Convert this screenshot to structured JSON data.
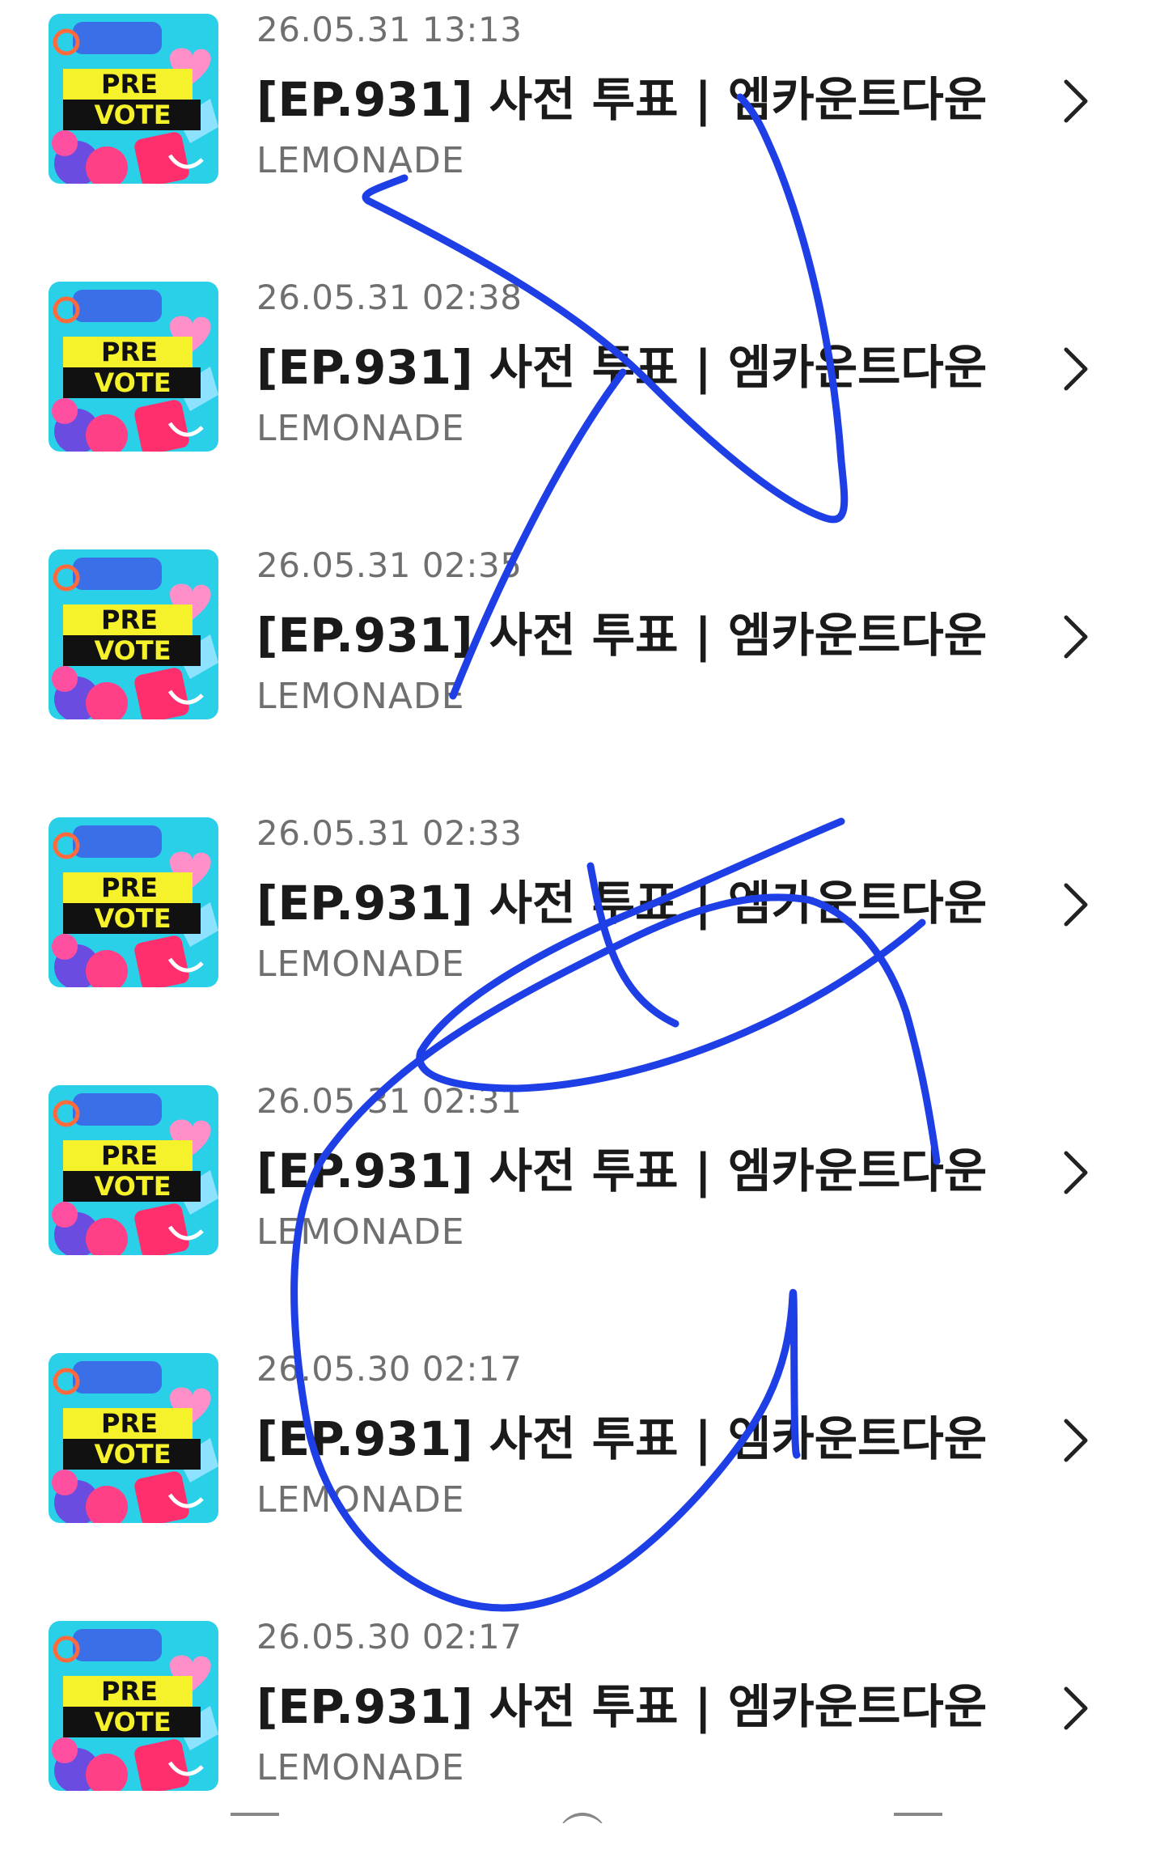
{
  "items": [
    {
      "date": "26.05.31 13:13",
      "title": "[EP.931] 사전 투표 | 엠카운트다운",
      "artist": "LEMONADE",
      "thumb_line1": "PRE",
      "thumb_line2": "VOTE"
    },
    {
      "date": "26.05.31 02:38",
      "title": "[EP.931] 사전 투표 | 엠카운트다운",
      "artist": "LEMONADE",
      "thumb_line1": "PRE",
      "thumb_line2": "VOTE"
    },
    {
      "date": "26.05.31 02:35",
      "title": "[EP.931] 사전 투표 | 엠카운트다운",
      "artist": "LEMONADE",
      "thumb_line1": "PRE",
      "thumb_line2": "VOTE"
    },
    {
      "date": "26.05.31 02:33",
      "title": "[EP.931] 사전 투표 | 엠카운트다운",
      "artist": "LEMONADE",
      "thumb_line1": "PRE",
      "thumb_line2": "VOTE"
    },
    {
      "date": "26.05.31 02:31",
      "title": "[EP.931] 사전 투표 | 엠카운트다운",
      "artist": "LEMONADE",
      "thumb_line1": "PRE",
      "thumb_line2": "VOTE"
    },
    {
      "date": "26.05.30 02:17",
      "title": "[EP.931] 사전 투표 | 엠카운트다운",
      "artist": "LEMONADE",
      "thumb_line1": "PRE",
      "thumb_line2": "VOTE"
    },
    {
      "date": "26.05.30 02:17",
      "title": "[EP.931] 사전 투표 | 엠카운트다운",
      "artist": "LEMONADE",
      "thumb_line1": "PRE",
      "thumb_line2": "VOTE"
    }
  ],
  "icons": {
    "row_action": "chevron-right-icon",
    "annotation": "blue-pen-scribble"
  },
  "colors": {
    "annotation_ink": "#1f3fe6",
    "thumb_bg": "#2ad0e8",
    "thumb_banner": "#f5f12a",
    "thumb_accent": "#ff3f86"
  },
  "navbar": {
    "icons": [
      "recent-apps-icon",
      "home-icon",
      "back-icon"
    ]
  }
}
